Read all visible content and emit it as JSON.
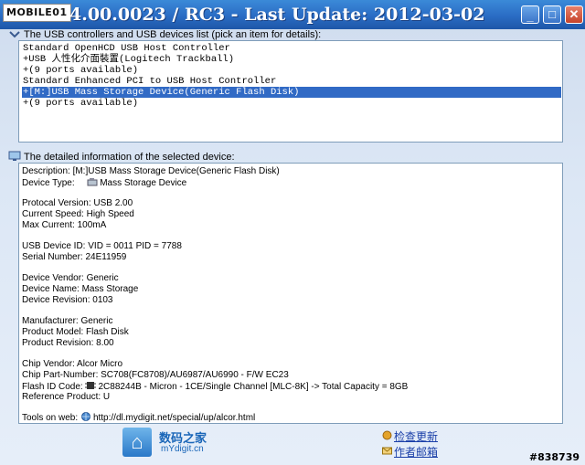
{
  "titlebar": {
    "logo": "MOBILE01",
    "title": "4.00.0023 / RC3 - Last Update: 2012-03-02",
    "buttons": {
      "minimize": "_",
      "maximize": "□",
      "close": "✕"
    }
  },
  "usb_list": {
    "label": "The USB controllers and USB devices list (pick an item for details):",
    "items": [
      {
        "text": "Standard OpenHCD USB Host Controller",
        "selected": false
      },
      {
        "text": "+USB 人性化介面裝置(Logitech Trackball)",
        "selected": false
      },
      {
        "text": "+(9 ports available)",
        "selected": false
      },
      {
        "text": "Standard Enhanced PCI to USB Host Controller",
        "selected": false
      },
      {
        "text": "+[M:]USB Mass Storage Device(Generic Flash Disk)",
        "selected": true
      },
      {
        "text": "+(9 ports available)",
        "selected": false
      }
    ]
  },
  "details": {
    "label": "The detailed information of the selected device:",
    "lines": [
      "Description: [M:]USB Mass Storage Device(Generic Flash Disk)",
      "Device Type:",
      "Mass Storage Device",
      "Protocal Version: USB 2.00",
      "Current Speed: High Speed",
      "Max Current: 100mA",
      "USB Device ID: VID = 0011 PID = 7788",
      "Serial Number: 24E11959",
      "Device Vendor: Generic",
      "Device Name: Mass Storage",
      "Device Revision: 0103",
      "Manufacturer: Generic",
      "Product Model: Flash Disk",
      "Product Revision: 8.00",
      "Chip Vendor: Alcor Micro",
      "Chip Part-Number: SC708(FC8708)/AU6987/AU6990 - F/W EC23",
      "Flash ID Code:",
      "2C88244B - Micron - 1CE/Single Channel [MLC-8K] -> Total Capacity = 8GB",
      "Reference Product: U",
      "Tools on web:",
      "http://dl.mydigit.net/special/up/alcor.html"
    ]
  },
  "footer": {
    "site_name": "数码之家",
    "site_url": "mYdigit.cn",
    "check_update": "检查更新",
    "author_email": "作者邮箱",
    "watermark": "#838739"
  }
}
